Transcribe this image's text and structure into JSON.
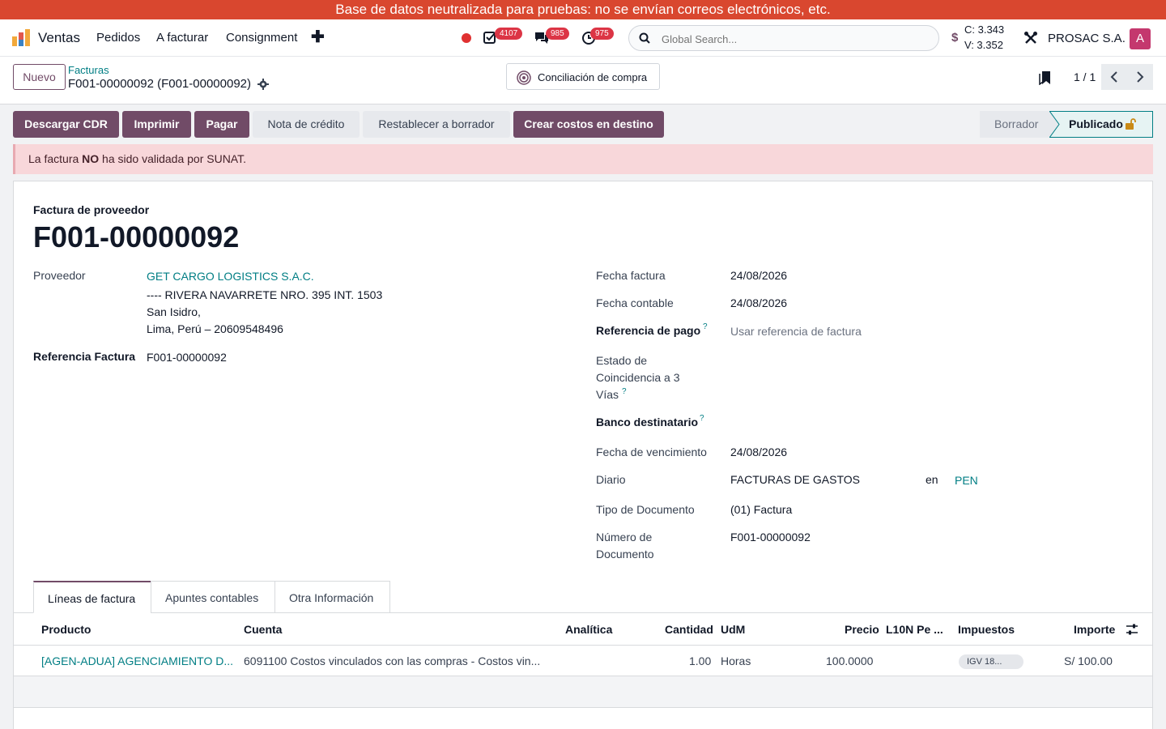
{
  "banner": "Base de datos neutralizada para pruebas: no se envían correos electrónicos, etc.",
  "navbar": {
    "app_name": "Ventas",
    "menu": [
      "Pedidos",
      "A facturar",
      "Consignment"
    ],
    "badges": {
      "activities": "4107",
      "messages": "985",
      "clock": "975"
    },
    "search_placeholder": "Global Search...",
    "rate_c": "C: 3.343",
    "rate_v": "V: 3.352",
    "company": "PROSAC S.A.",
    "avatar_letter": "A"
  },
  "control": {
    "new_label": "Nuevo",
    "breadcrumb_parent": "Facturas",
    "breadcrumb_current": "F001-00000092 (F001-00000092)",
    "concil_label": "Conciliación de compra",
    "pager": "1 / 1"
  },
  "actions": {
    "download_cdr": "Descargar CDR",
    "print": "Imprimir",
    "pay": "Pagar",
    "credit_note": "Nota de crédito",
    "reset_draft": "Restablecer a borrador",
    "landed_costs": "Crear costos en destino"
  },
  "status": {
    "draft": "Borrador",
    "posted": "Publicado"
  },
  "alert": {
    "pre": "La factura ",
    "strong": "NO",
    "post": " ha sido validada por SUNAT."
  },
  "form": {
    "subtitle": "Factura de proveedor",
    "title": "F001-00000092",
    "vendor_label": "Proveedor",
    "vendor_name": "GET CARGO LOGISTICS S.A.C.",
    "vendor_addr1": "---- RIVERA NAVARRETE NRO. 395 INT. 1503",
    "vendor_addr2": "San Isidro,",
    "vendor_addr3": "Lima, Perú – 20609548496",
    "ref_label": "Referencia Factura",
    "ref_value": "F001-00000092",
    "invoice_date_label": "Fecha factura",
    "invoice_date": "24/08/2026",
    "accounting_date_label": "Fecha contable",
    "accounting_date": "24/08/2026",
    "payment_ref_label": "Referencia de pago",
    "payment_ref_placeholder": "Usar referencia de factura",
    "match_label_1": "Estado de",
    "match_label_2": "Coincidencia a 3",
    "match_label_3": "Vías",
    "bank_label": "Banco destinatario",
    "due_date_label": "Fecha de vencimiento",
    "due_date": "24/08/2026",
    "journal_label": "Diario",
    "journal": "FACTURAS DE GASTOS",
    "in_label": "en",
    "currency": "PEN",
    "doc_type_label": "Tipo de Documento",
    "doc_type": "(01) Factura",
    "doc_number_label_1": "Número de",
    "doc_number_label_2": "Documento",
    "doc_number": "F001-00000092",
    "help_mark": "?"
  },
  "tabs": [
    "Líneas de factura",
    "Apuntes contables",
    "Otra Información"
  ],
  "table": {
    "headers": [
      "Producto",
      "Cuenta",
      "Analítica",
      "Cantidad",
      "UdM",
      "Precio",
      "L10N Pe ...",
      "Impuestos",
      "Importe"
    ],
    "rows": [
      {
        "product": "[AGEN-ADUA] AGENCIAMIENTO D...",
        "account": "6091100 Costos vinculados con las compras - Costos vin...",
        "analytic": "",
        "quantity": "1.00",
        "uom": "Horas",
        "price": "100.0000",
        "l10n": "",
        "taxes": "IGV 18...",
        "amount": "S/ 100.00"
      }
    ]
  },
  "colors": {
    "brand": "#714b67",
    "link": "#017e84",
    "banner": "#d9472f",
    "badge": "#dc3545",
    "alert_bg": "#f8d7da"
  }
}
